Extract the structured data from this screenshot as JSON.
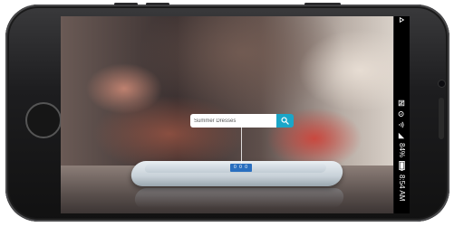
{
  "search": {
    "value": "Summer Dresses",
    "placeholder": ""
  },
  "device_tag": {
    "label": "0 0 0"
  },
  "status_bar": {
    "battery": "84%",
    "time": "8:54 AM"
  },
  "icons": {
    "search": "magnifier-icon",
    "notification": "notification-icon",
    "alarm": "alarm-icon",
    "wifi": "wifi-icon",
    "battery": "battery-icon",
    "nfc": "nfc-icon"
  },
  "colors": {
    "search_button": "#1aa6c8",
    "tag": "#2a6fbf"
  }
}
